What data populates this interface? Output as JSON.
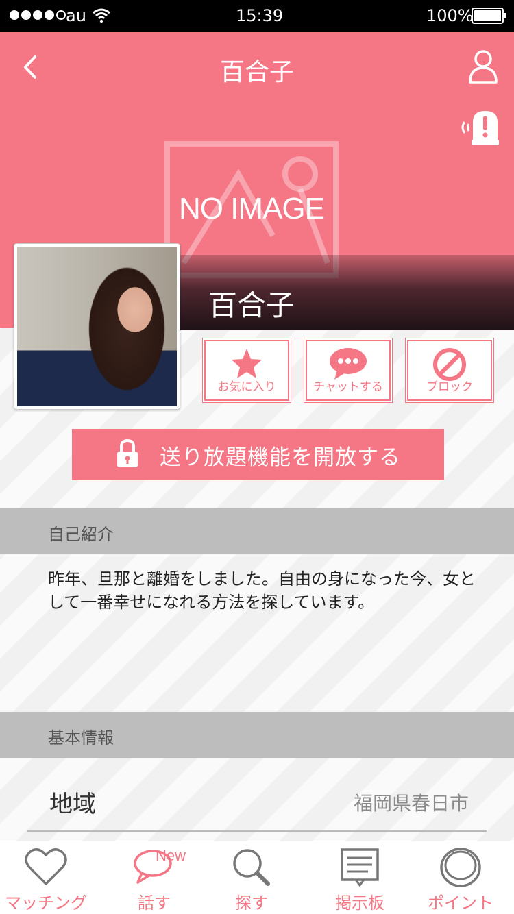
{
  "status_bar": {
    "carrier": "au",
    "time": "15:39",
    "battery": "100%"
  },
  "header": {
    "title": "百合子"
  },
  "profile": {
    "placeholder_text": "NO IMAGE",
    "name": "百合子"
  },
  "actions": [
    {
      "label": "お気に入り",
      "icon": "star-icon"
    },
    {
      "label": "チャットする",
      "icon": "chat-bubble-icon"
    },
    {
      "label": "ブロック",
      "icon": "block-icon"
    }
  ],
  "unlock": {
    "label": "送り放題機能を開放する",
    "icon": "lock-icon"
  },
  "intro": {
    "heading": "自己紹介",
    "text": "昨年、旦那と離婚をしました。自由の身になった今、女として一番幸せになれる方法を探しています。"
  },
  "basic_info": {
    "heading": "基本情報",
    "region_label": "地域",
    "region_value": "福岡県春日市"
  },
  "tabs": [
    {
      "label": "マッチング",
      "icon": "heart-icon"
    },
    {
      "label": "話す",
      "icon": "speech-bubble-icon",
      "badge": "New"
    },
    {
      "label": "探す",
      "icon": "magnifier-icon"
    },
    {
      "label": "掲示板",
      "icon": "bulletin-board-icon"
    },
    {
      "label": "ポイント",
      "icon": "coin-icon"
    }
  ],
  "colors": {
    "accent": "#f57684",
    "section_header": "#bdbdbd"
  }
}
